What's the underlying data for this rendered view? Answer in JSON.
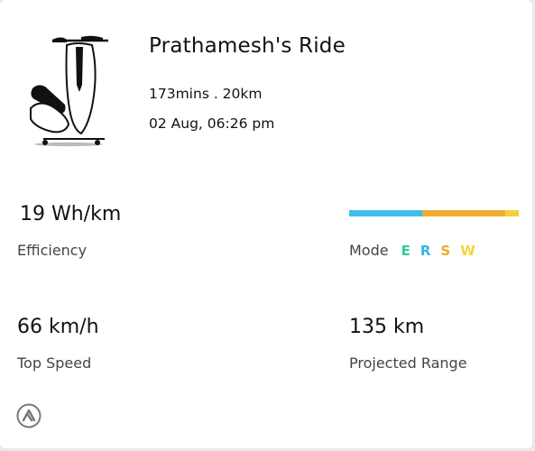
{
  "ride": {
    "title": "Prathamesh's Ride",
    "duration_distance": "173mins . 20km",
    "datetime": "02 Aug, 06:26 pm"
  },
  "stats": {
    "efficiency": {
      "value": "19 Wh/km",
      "label": "Efficiency"
    },
    "top_speed": {
      "value": "66 km/h",
      "label": "Top Speed"
    },
    "projected_range": {
      "value": "135 km",
      "label": "Projected Range"
    }
  },
  "mode": {
    "label": "Mode",
    "letters": [
      {
        "text": "E",
        "color": "#2fcf9a"
      },
      {
        "text": "R",
        "color": "#33b6e6"
      },
      {
        "text": "S",
        "color": "#f0a928"
      },
      {
        "text": "W",
        "color": "#f2d63a"
      }
    ],
    "distribution": [
      {
        "mode": "R",
        "fraction": 0.43,
        "color": "#3fbfe8"
      },
      {
        "mode": "S",
        "fraction": 0.49,
        "color": "#f0ad33"
      },
      {
        "mode": "W",
        "fraction": 0.08,
        "color": "#f6d03a"
      }
    ]
  },
  "icons": {
    "scooter": "scooter-icon",
    "brand": "ather-logo-icon"
  }
}
